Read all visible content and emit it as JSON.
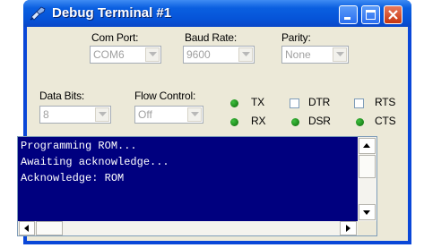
{
  "window": {
    "title": "Debug Terminal #1",
    "controls": [
      "minimize",
      "maximize",
      "close"
    ]
  },
  "settings": {
    "com_port": {
      "label": "Com Port:",
      "value": "COM6"
    },
    "baud_rate": {
      "label": "Baud Rate:",
      "value": "9600"
    },
    "parity": {
      "label": "Parity:",
      "value": "None"
    },
    "data_bits": {
      "label": "Data Bits:",
      "value": "8"
    },
    "flow_control": {
      "label": "Flow Control:",
      "value": "Off"
    }
  },
  "indicators": {
    "tx": {
      "label": "TX",
      "state": "green-led"
    },
    "rx": {
      "label": "RX",
      "state": "green-led"
    },
    "dtr": {
      "label": "DTR",
      "checked": false
    },
    "rts": {
      "label": "RTS",
      "checked": false
    },
    "dsr": {
      "label": "DSR",
      "state": "green-led"
    },
    "cts": {
      "label": "CTS",
      "state": "green-led"
    }
  },
  "terminal": {
    "lines": [
      "Programming ROM...",
      "Awaiting acknowledge...",
      "Acknowledge: ROM"
    ],
    "background_color": "#00007f",
    "text_color": "#ffffff"
  }
}
